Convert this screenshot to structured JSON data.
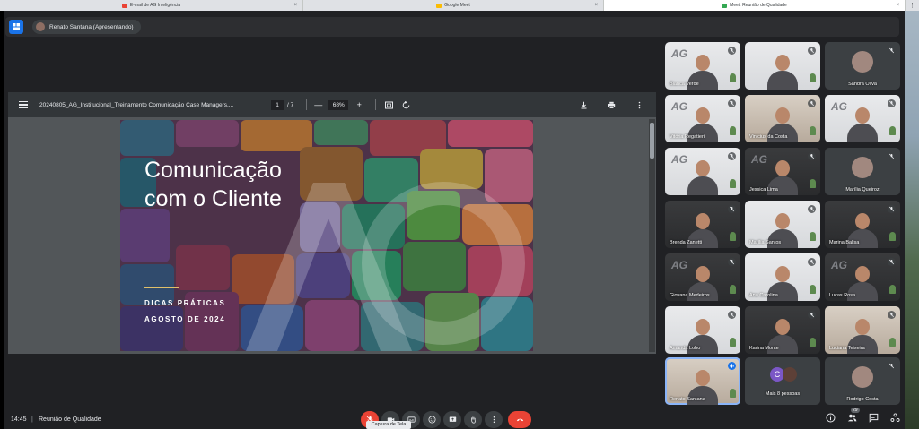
{
  "browser_tabs": [
    {
      "label": "E-mail de AG Inteligência",
      "fav_color": "#ea4335"
    },
    {
      "label": "Google Meet",
      "fav_color": "#fbbc04"
    },
    {
      "label": "Meet: Reunião de Qualidade",
      "fav_color": "#34a853"
    }
  ],
  "presenter": {
    "name": "Renato Santana (Apresentando)"
  },
  "viewer": {
    "doc_title": "20240805_AG_Institucional_Treinamento Comunicação Case Managers....",
    "page_current": "1",
    "page_total": "/ 7",
    "zoom": "68%",
    "minus": "—",
    "plus": "+"
  },
  "slide": {
    "title": "Comunicação\ncom o Cliente",
    "subtitle": "DICAS PRÁTICAS",
    "date": "AGOSTO DE 2024"
  },
  "participants": [
    {
      "name": "Bianca Verde",
      "style": "video",
      "logo": "AG",
      "muted": true
    },
    {
      "name": "",
      "style": "video",
      "logo": "",
      "muted": true
    },
    {
      "name": "Sandra Oliva",
      "style": "avatar-only",
      "logo": "",
      "muted": true
    },
    {
      "name": "Vitória Regatieri",
      "style": "video",
      "logo": "AG",
      "muted": true
    },
    {
      "name": "Vinicius da Costa",
      "style": "video warm",
      "logo": "",
      "muted": true
    },
    {
      "name": "",
      "style": "video",
      "logo": "AG",
      "muted": true
    },
    {
      "name": "",
      "style": "video",
      "logo": "AG",
      "muted": true
    },
    {
      "name": "Jessica Lima",
      "style": "video dark",
      "logo": "AG",
      "muted": true
    },
    {
      "name": "Marília Queiroz",
      "style": "avatar-only",
      "logo": "",
      "muted": true
    },
    {
      "name": "Brenda Zanetti",
      "style": "video dark",
      "logo": "",
      "muted": true
    },
    {
      "name": "Marília Santos",
      "style": "video",
      "logo": "",
      "muted": true
    },
    {
      "name": "Marina Balisa",
      "style": "video dark",
      "logo": "",
      "muted": true
    },
    {
      "name": "Giovana Medeiros",
      "style": "video dark",
      "logo": "AG",
      "muted": true
    },
    {
      "name": "Ana Carolina",
      "style": "video",
      "logo": "",
      "muted": true
    },
    {
      "name": "Lucas Rosa",
      "style": "video dark",
      "logo": "AG",
      "muted": true
    },
    {
      "name": "Amanda Lobo",
      "style": "video",
      "logo": "",
      "muted": true
    },
    {
      "name": "Karina Monte",
      "style": "video dark",
      "logo": "",
      "muted": true
    },
    {
      "name": "Luciana Teixeira",
      "style": "video warm",
      "logo": "",
      "muted": true
    },
    {
      "name": "Renato Santana",
      "style": "video warm active",
      "logo": "",
      "muted": false
    },
    {
      "name": "Mais 8 pessoas",
      "style": "avatar-only more",
      "logo": "",
      "muted": false
    },
    {
      "name": "Rodrigo Costa",
      "style": "avatar-only",
      "logo": "",
      "muted": true
    }
  ],
  "more_people_initial": "C",
  "footer": {
    "time": "14:45",
    "separator": "|",
    "meeting": "Reunião de Qualidade",
    "capture_tip": "Captura de Tela",
    "badge": "29"
  },
  "colors": {
    "accent_blue": "#1a73e8",
    "end_call_red": "#ea4335",
    "meet_bg": "#202124"
  }
}
